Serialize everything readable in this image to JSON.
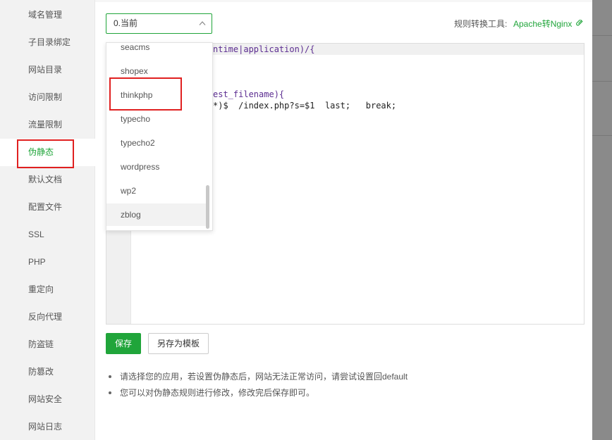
{
  "sidebar": {
    "items": [
      {
        "label": "域名管理"
      },
      {
        "label": "子目录绑定"
      },
      {
        "label": "网站目录"
      },
      {
        "label": "访问限制"
      },
      {
        "label": "流量限制"
      },
      {
        "label": "伪静态",
        "active": true
      },
      {
        "label": "默认文档"
      },
      {
        "label": "配置文件"
      },
      {
        "label": "SSL"
      },
      {
        "label": "PHP"
      },
      {
        "label": "重定向"
      },
      {
        "label": "反向代理"
      },
      {
        "label": "防盗链"
      },
      {
        "label": "防篡改"
      },
      {
        "label": "网站安全"
      },
      {
        "label": "网站日志"
      }
    ]
  },
  "template_select": {
    "selected": "0.当前",
    "options": [
      "seacms",
      "shopex",
      "thinkphp",
      "typecho",
      "typecho2",
      "wordpress",
      "wp2",
      "zblog"
    ],
    "hovered": "zblog",
    "highlighted": "thinkphp"
  },
  "converter": {
    "label": "规则转换工具:",
    "link": "Apache转Nginx"
  },
  "editor": {
    "line1_visible": "ntime|application)/{",
    "line3_visible": "est_filename){",
    "line4_visible": "*)$  /index.php?s=$1  last;   break;"
  },
  "buttons": {
    "save": "保存",
    "save_template": "另存为模板"
  },
  "tips": [
    "请选择您的应用，若设置伪静态后，网站无法正常访问，请尝试设置回default",
    "您可以对伪静态规则进行修改，修改完后保存即可。"
  ],
  "colors": {
    "accent": "#20a53a",
    "highlight_border": "#e02020"
  },
  "icons": {
    "select_arrow": "chevron-up-icon",
    "converter_link": "link-icon"
  }
}
